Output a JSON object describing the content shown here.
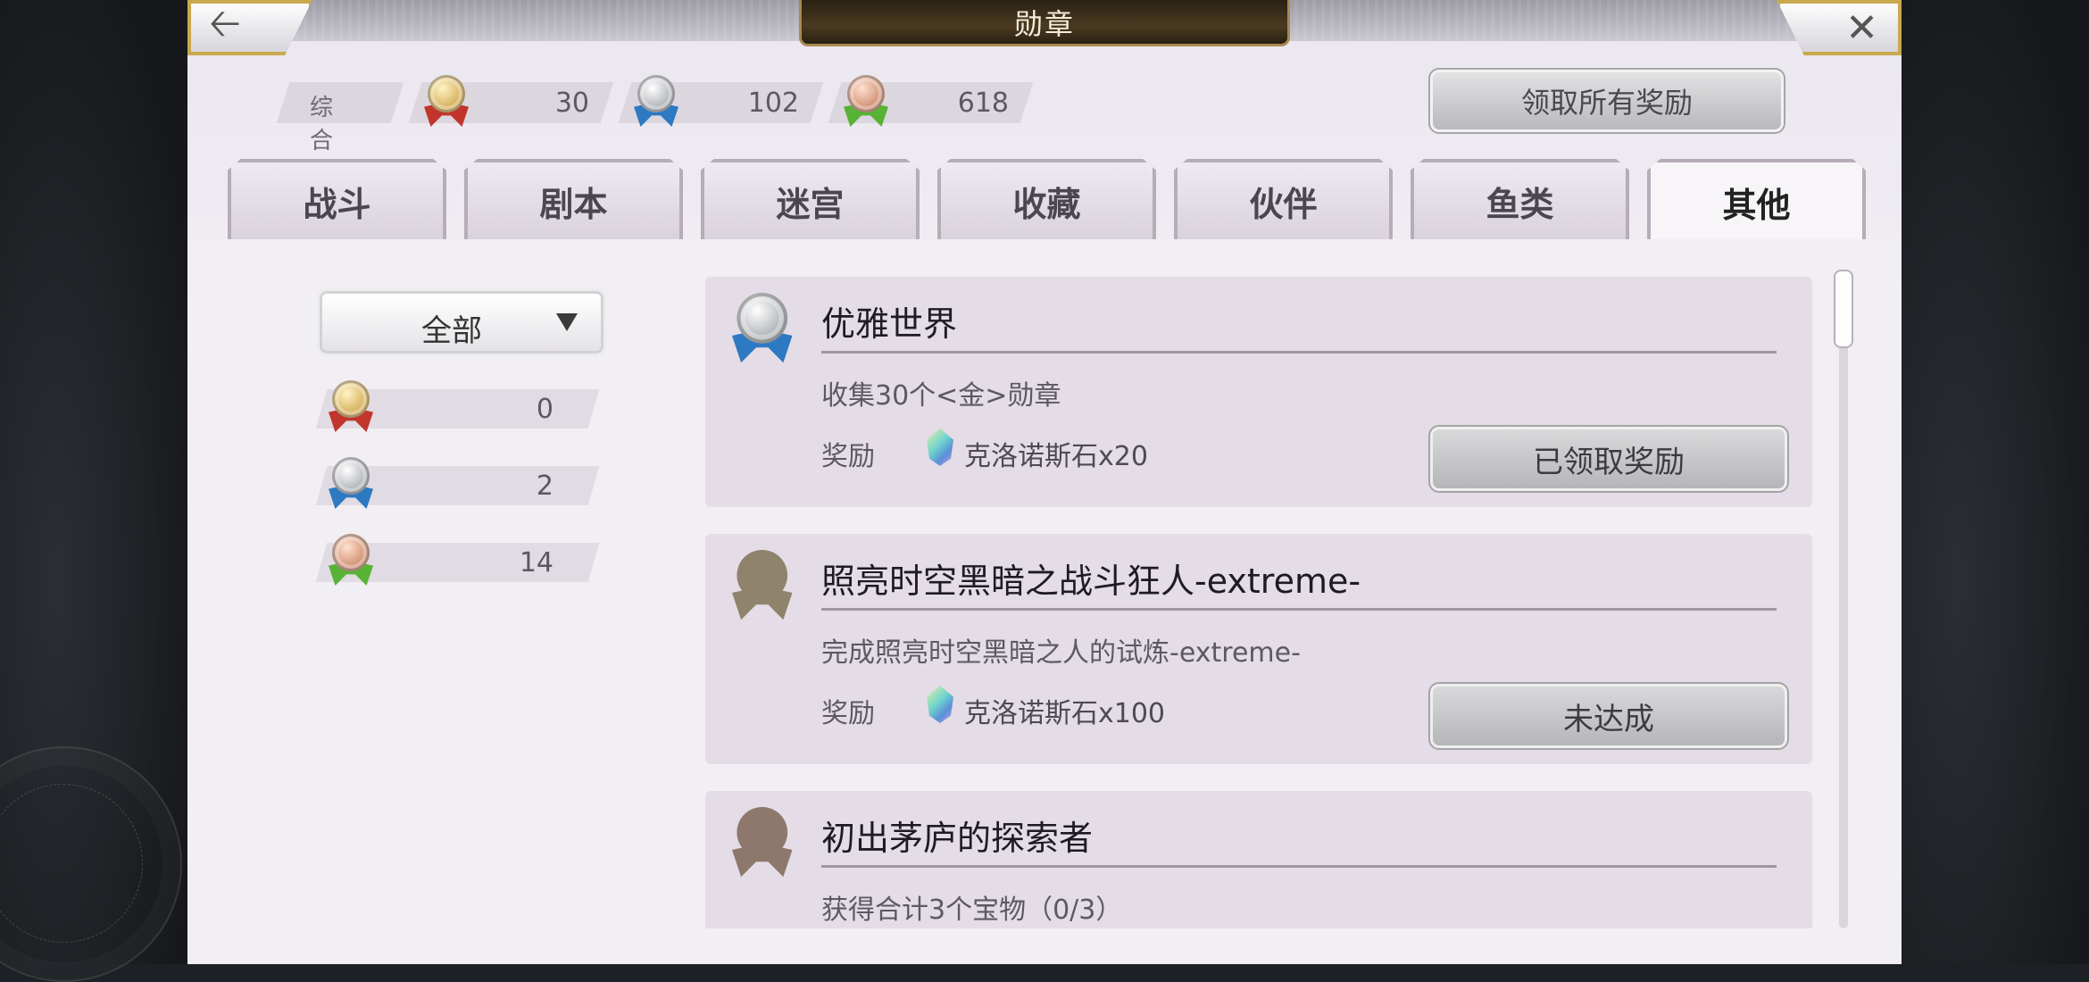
{
  "title": "勋章",
  "summary": {
    "overall_label": "综合",
    "gold": "30",
    "silver": "102",
    "bronze": "618"
  },
  "claim_all_label": "领取所有奖励",
  "tabs": [
    "战斗",
    "剧本",
    "迷宫",
    "收藏",
    "伙伴",
    "鱼类",
    "其他"
  ],
  "active_tab": "其他",
  "filter": {
    "selected": "全部"
  },
  "counts": {
    "gold": "0",
    "silver": "2",
    "bronze": "14"
  },
  "achievements": [
    {
      "title": "优雅世界",
      "desc": "收集30个<金>勋章",
      "reward_label": "奖励",
      "reward": "克洛诺斯石x20",
      "button": "已领取奖励",
      "medal": "silver"
    },
    {
      "title": "照亮时空黑暗之战斗狂人-extreme-",
      "desc": "完成照亮时空黑暗之人的试炼-extreme-",
      "reward_label": "奖励",
      "reward": "克洛诺斯石x100",
      "button": "未达成",
      "medal": "locked"
    },
    {
      "title": "初出茅庐的探索者",
      "desc": "获得合计3个宝物（0/3）",
      "medal": "locked"
    }
  ],
  "icons": {
    "back": "arrow-left-icon",
    "close": "close-icon",
    "gem": "chronos-stone-icon",
    "dropdown": "triangle-down-icon"
  }
}
